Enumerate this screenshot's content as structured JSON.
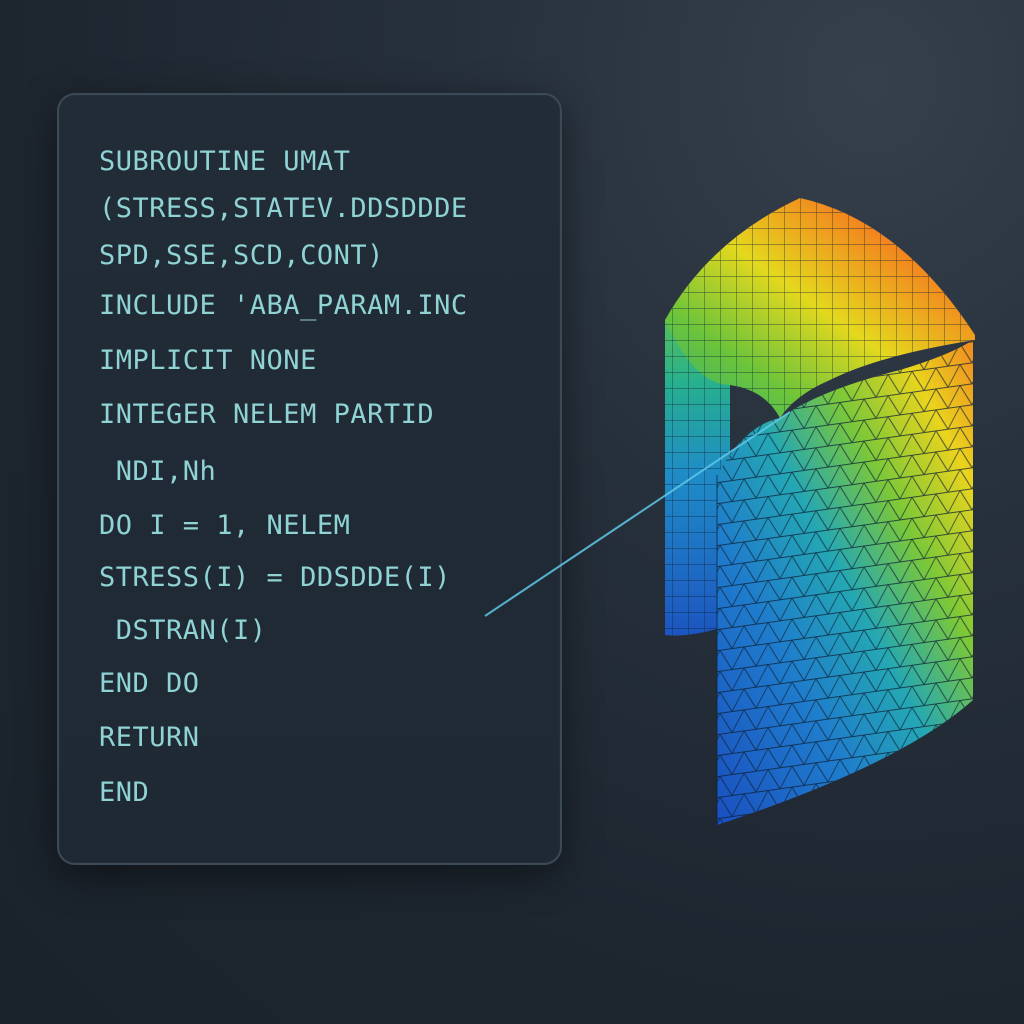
{
  "code": {
    "lines": [
      "SUBROUTINE UMAT",
      "(STRESS,STATEV.DDSDDDE",
      "SPD,SSE,SCD,CONT)",
      "INCLUDE 'ABA_PARAM.INC",
      "IMPLICIT NONE",
      "INTEGER NELEM PARTID",
      " NDI,Nh",
      "DO I = 1, NELEM",
      "STRESS(I) = DDSDDE(I)",
      " DSTRAN(I)",
      "END DO",
      "RETURN",
      "END"
    ],
    "text_color": "#8fd3d4"
  },
  "mesh": {
    "colormap": [
      "#1f5fc8",
      "#21a4c4",
      "#5cc444",
      "#e6dc1e",
      "#f07a1e",
      "#e8401e"
    ]
  }
}
